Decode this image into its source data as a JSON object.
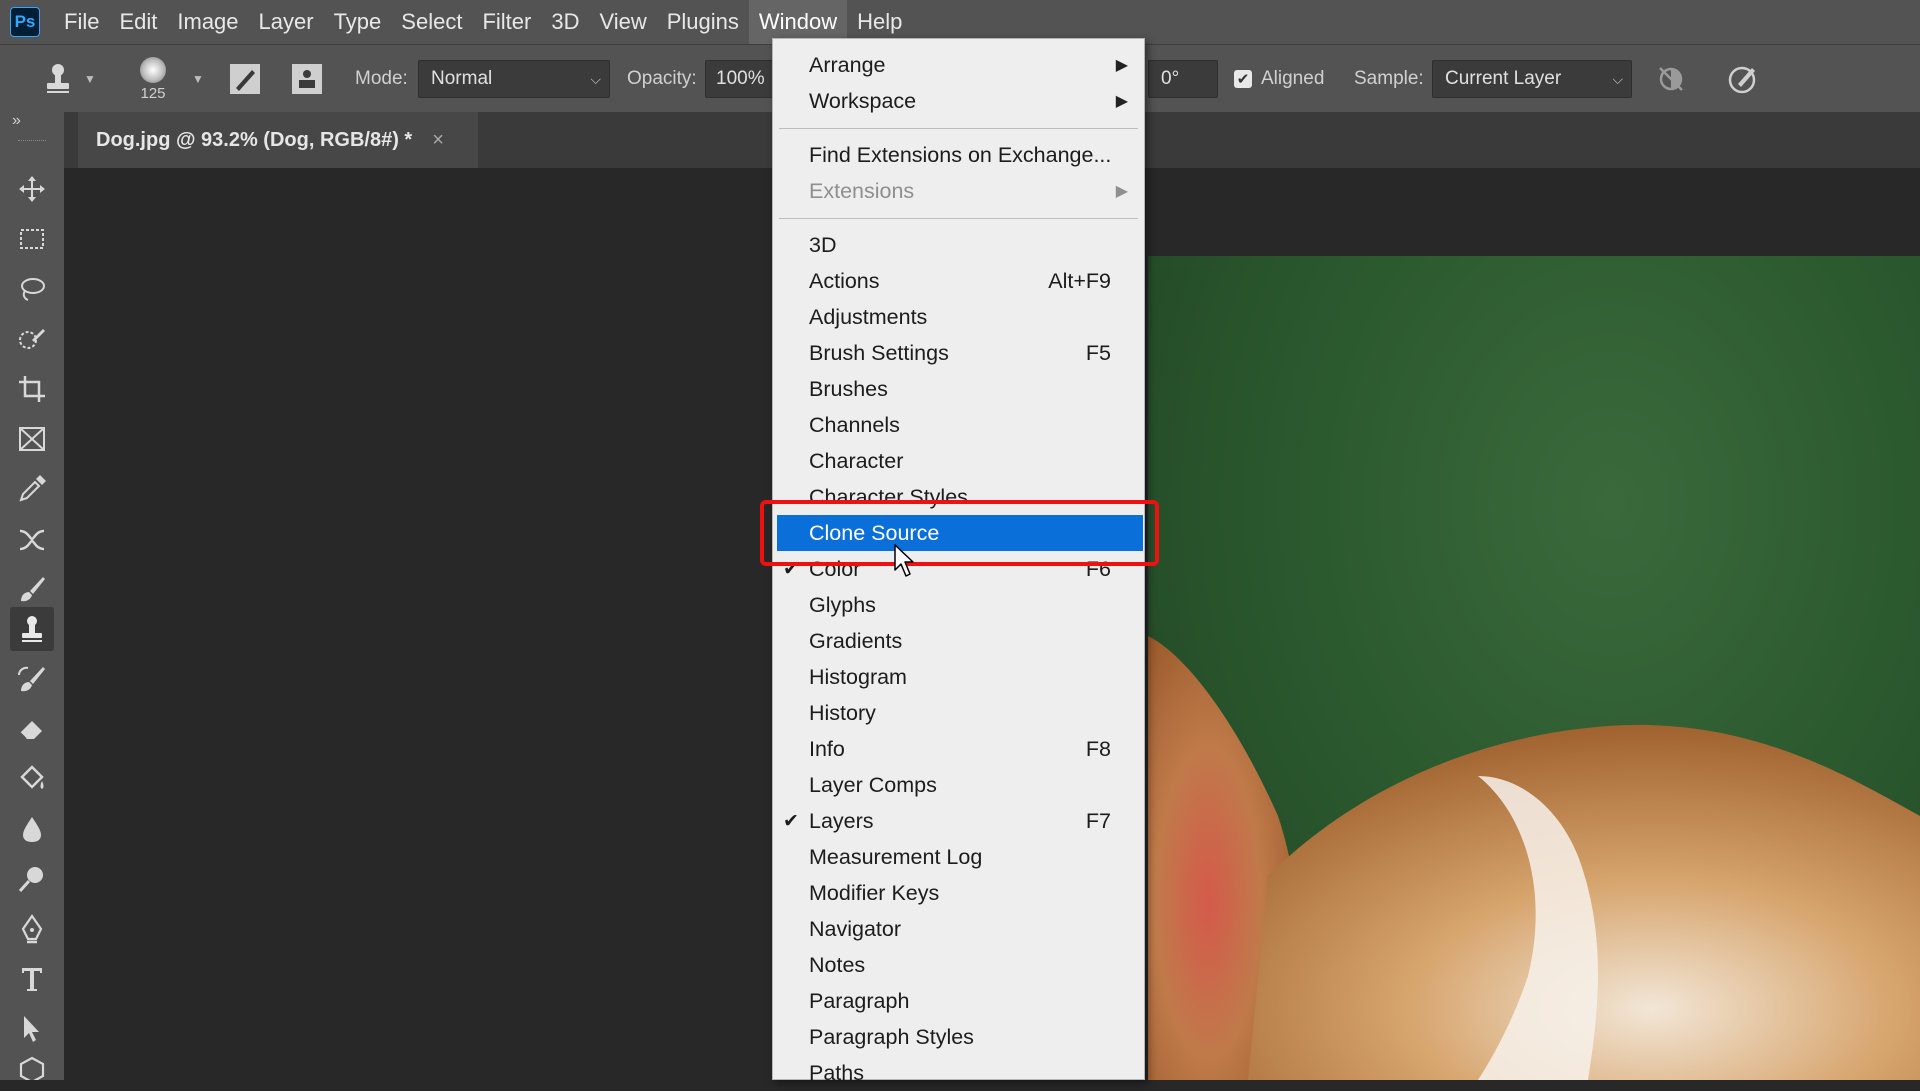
{
  "app": {
    "logo_text": "Ps"
  },
  "menubar": {
    "items": [
      "File",
      "Edit",
      "Image",
      "Layer",
      "Type",
      "Select",
      "Filter",
      "3D",
      "View",
      "Plugins",
      "Window",
      "Help"
    ],
    "active": "Window"
  },
  "options_bar": {
    "brush_size": "125",
    "mode_label": "Mode:",
    "mode_value": "Normal",
    "opacity_label": "Opacity:",
    "opacity_value": "100%",
    "angle_value": "0°",
    "aligned_label": "Aligned",
    "aligned_checked": true,
    "sample_label": "Sample:",
    "sample_value": "Current Layer"
  },
  "document_tab": {
    "title": "Dog.jpg @ 93.2% (Dog, RGB/8#) *",
    "close_glyph": "×"
  },
  "toolbar": {
    "collapse_glyph": "»",
    "tools": [
      "move-tool",
      "marquee-tool",
      "lasso-tool",
      "quick-selection-tool",
      "crop-tool",
      "frame-tool",
      "eyedropper-tool",
      "healing-tool",
      "brush-tool",
      "clone-stamp-tool",
      "history-brush-tool",
      "eraser-tool",
      "paint-bucket-tool",
      "blur-tool",
      "dodge-tool",
      "pen-tool",
      "type-tool",
      "path-selection-tool",
      "shape-tool"
    ],
    "active_tool": "clone-stamp-tool"
  },
  "window_menu": {
    "items": [
      {
        "label": "Arrange",
        "submenu": true
      },
      {
        "label": "Workspace",
        "submenu": true
      },
      {
        "separator": true
      },
      {
        "label": "Find Extensions on Exchange..."
      },
      {
        "label": "Extensions",
        "submenu": true,
        "disabled": true
      },
      {
        "separator": true
      },
      {
        "label": "3D"
      },
      {
        "label": "Actions",
        "shortcut": "Alt+F9"
      },
      {
        "label": "Adjustments"
      },
      {
        "label": "Brush Settings",
        "shortcut": "F5"
      },
      {
        "label": "Brushes"
      },
      {
        "label": "Channels"
      },
      {
        "label": "Character"
      },
      {
        "label": "Character Styles"
      },
      {
        "label": "Clone Source",
        "highlighted": true
      },
      {
        "label": "Color",
        "shortcut": "F6",
        "checked": true
      },
      {
        "label": "Glyphs"
      },
      {
        "label": "Gradients"
      },
      {
        "label": "Histogram"
      },
      {
        "label": "History"
      },
      {
        "label": "Info",
        "shortcut": "F8"
      },
      {
        "label": "Layer Comps"
      },
      {
        "label": "Layers",
        "shortcut": "F7",
        "checked": true
      },
      {
        "label": "Measurement Log"
      },
      {
        "label": "Modifier Keys"
      },
      {
        "label": "Navigator"
      },
      {
        "label": "Notes"
      },
      {
        "label": "Paragraph"
      },
      {
        "label": "Paragraph Styles"
      },
      {
        "label": "Paths"
      }
    ]
  },
  "glyphs": {
    "check": "✔",
    "submenu_arrow": "▶",
    "dropdown_chevron": "⌵"
  },
  "colors": {
    "menu_highlight": "#0a6fd8",
    "annotation_red": "#ef1010",
    "panel_gray": "#535353",
    "canvas_bg": "#282828",
    "photo_green": "#2c5a2f"
  }
}
